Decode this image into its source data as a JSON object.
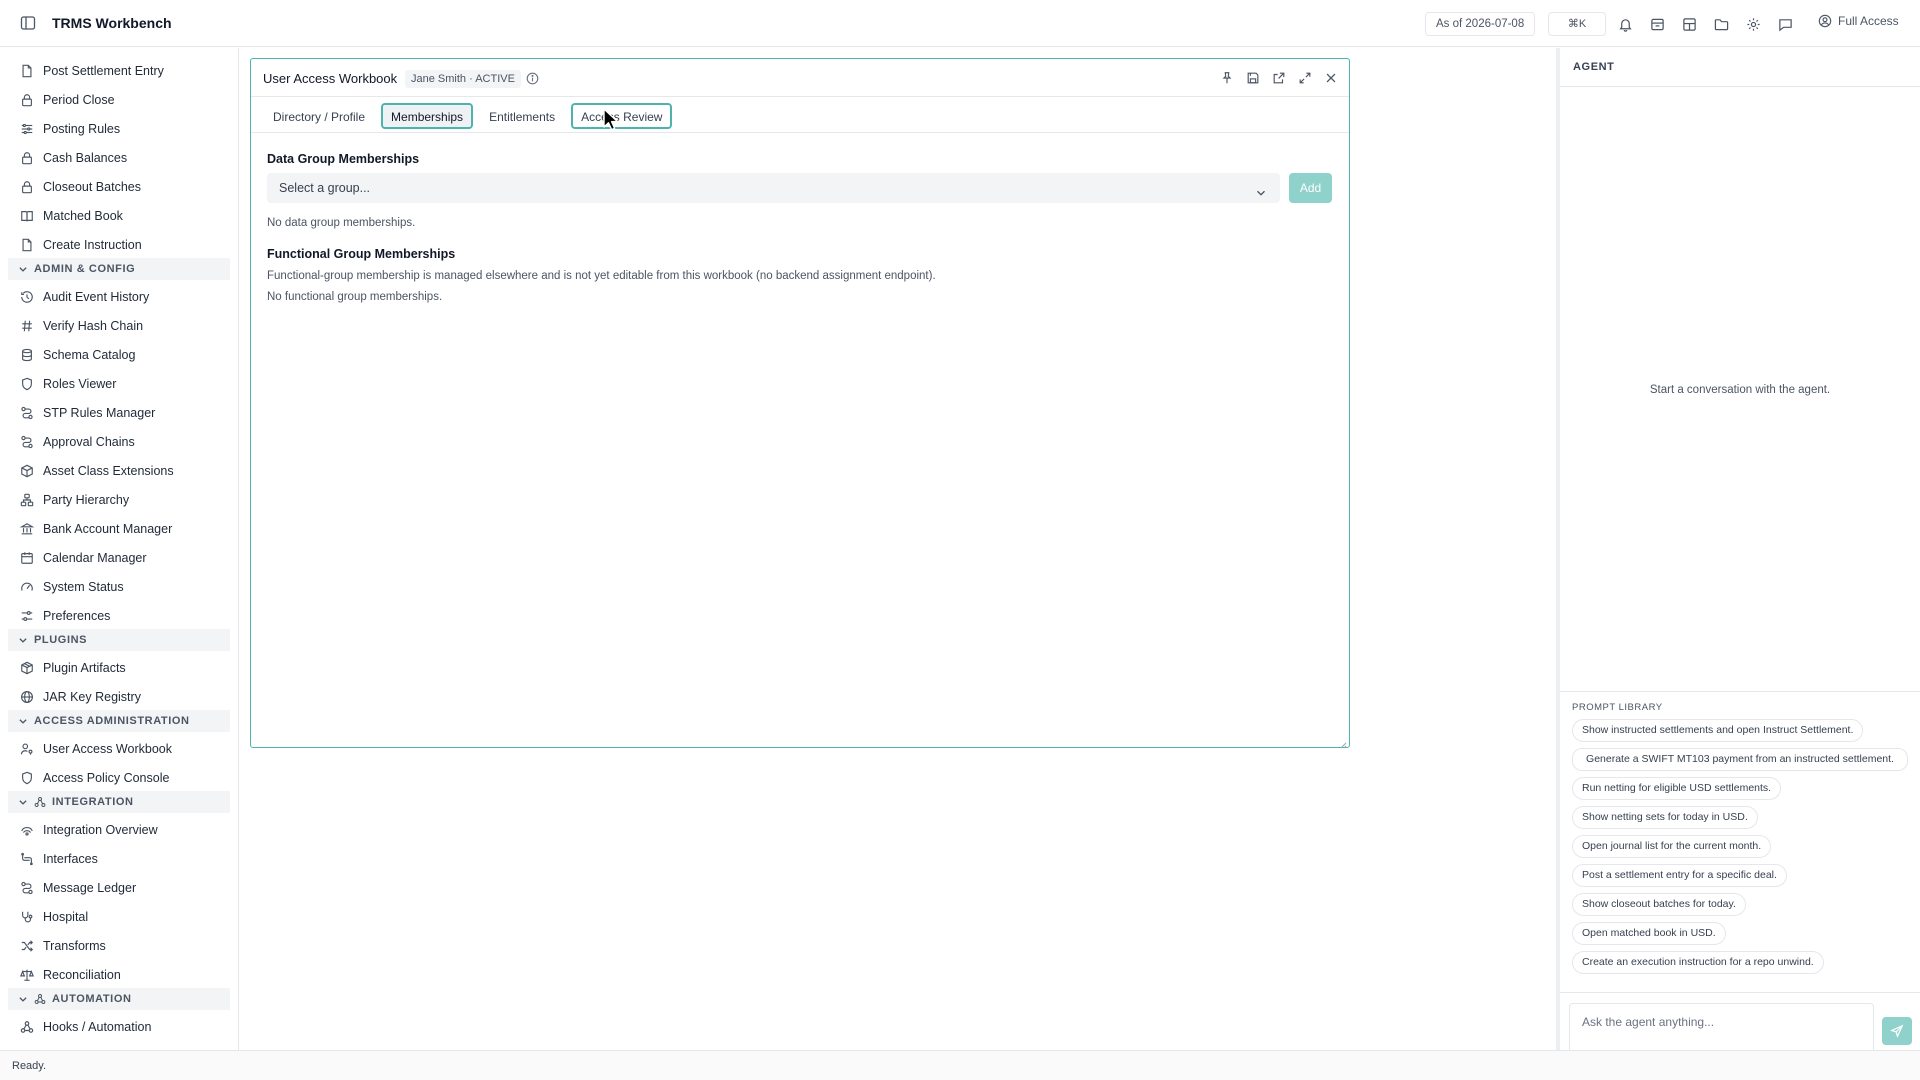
{
  "app": {
    "title": "TRMS Workbench",
    "as_of": "As of 2026-07-08",
    "shortcut": "⌘K",
    "access_label": "Full Access"
  },
  "sidebar": {
    "items_top": [
      {
        "label": "Post Settlement Entry",
        "icon": "document-icon"
      },
      {
        "label": "Period Close",
        "icon": "lock-icon"
      },
      {
        "label": "Posting Rules",
        "icon": "list-rules-icon"
      },
      {
        "label": "Cash Balances",
        "icon": "lock-icon"
      },
      {
        "label": "Closeout Batches",
        "icon": "lock-icon"
      },
      {
        "label": "Matched Book",
        "icon": "book-icon"
      },
      {
        "label": "Create Instruction",
        "icon": "document-icon"
      }
    ],
    "sections": [
      {
        "label": "ADMIN & CONFIG",
        "items": [
          {
            "label": "Audit Event History",
            "icon": "history-icon"
          },
          {
            "label": "Verify Hash Chain",
            "icon": "hash-icon"
          },
          {
            "label": "Schema Catalog",
            "icon": "database-icon"
          },
          {
            "label": "Roles Viewer",
            "icon": "shield-icon"
          },
          {
            "label": "STP Rules Manager",
            "icon": "route-icon"
          },
          {
            "label": "Approval Chains",
            "icon": "route-icon"
          },
          {
            "label": "Asset Class Extensions",
            "icon": "cube-icon"
          },
          {
            "label": "Party Hierarchy",
            "icon": "network-icon"
          },
          {
            "label": "Bank Account Manager",
            "icon": "bank-icon"
          },
          {
            "label": "Calendar Manager",
            "icon": "calendar-icon"
          },
          {
            "label": "System Status",
            "icon": "gauge-icon"
          },
          {
            "label": "Preferences",
            "icon": "sliders-icon"
          }
        ]
      },
      {
        "label": "PLUGINS",
        "items": [
          {
            "label": "Plugin Artifacts",
            "icon": "package-icon"
          },
          {
            "label": "JAR Key Registry",
            "icon": "globe-icon"
          }
        ]
      },
      {
        "label": "ACCESS ADMINISTRATION",
        "items": [
          {
            "label": "User Access Workbook",
            "icon": "user-key-icon"
          },
          {
            "label": "Access Policy Console",
            "icon": "shield-icon"
          }
        ]
      },
      {
        "label": "INTEGRATION",
        "items": [
          {
            "label": "Integration Overview",
            "icon": "integration-icon"
          },
          {
            "label": "Interfaces",
            "icon": "interfaces-icon"
          },
          {
            "label": "Message Ledger",
            "icon": "route-icon"
          },
          {
            "label": "Hospital",
            "icon": "stethoscope-icon"
          },
          {
            "label": "Transforms",
            "icon": "shuffle-icon"
          },
          {
            "label": "Reconciliation",
            "icon": "scale-icon"
          }
        ]
      },
      {
        "label": "AUTOMATION",
        "items": [
          {
            "label": "Hooks / Automation",
            "icon": "webhook-icon"
          }
        ]
      }
    ]
  },
  "panel": {
    "title": "User Access Workbook",
    "badge": "Jane Smith · ACTIVE",
    "tabs": [
      {
        "label": "Directory / Profile"
      },
      {
        "label": "Memberships"
      },
      {
        "label": "Entitlements"
      },
      {
        "label": "Access Review"
      }
    ],
    "data_groups": {
      "title": "Data Group Memberships",
      "select_placeholder": "Select a group...",
      "add_label": "Add",
      "empty": "No data group memberships."
    },
    "functional_groups": {
      "title": "Functional Group Memberships",
      "note": "Functional-group membership is managed elsewhere and is not yet editable from this workbook (no backend assignment endpoint).",
      "empty": "No functional group memberships."
    }
  },
  "agent": {
    "title": "AGENT",
    "empty": "Start a conversation with the agent.",
    "library_title": "PROMPT LIBRARY",
    "prompts": [
      "Show instructed settlements and open Instruct Settlement.",
      "Generate a SWIFT MT103 payment from an instructed settlement.",
      "Run netting for eligible USD settlements.",
      "Show netting sets for today in USD.",
      "Open journal list for the current month.",
      "Post a settlement entry for a specific deal.",
      "Show closeout batches for today.",
      "Open matched book in USD.",
      "Create an execution instruction for a repo unwind."
    ],
    "input_placeholder": "Ask the agent anything..."
  },
  "status": {
    "text": "Ready."
  },
  "colors": {
    "accent": "#4fb3ad",
    "accent_light": "#8fd1cb"
  }
}
